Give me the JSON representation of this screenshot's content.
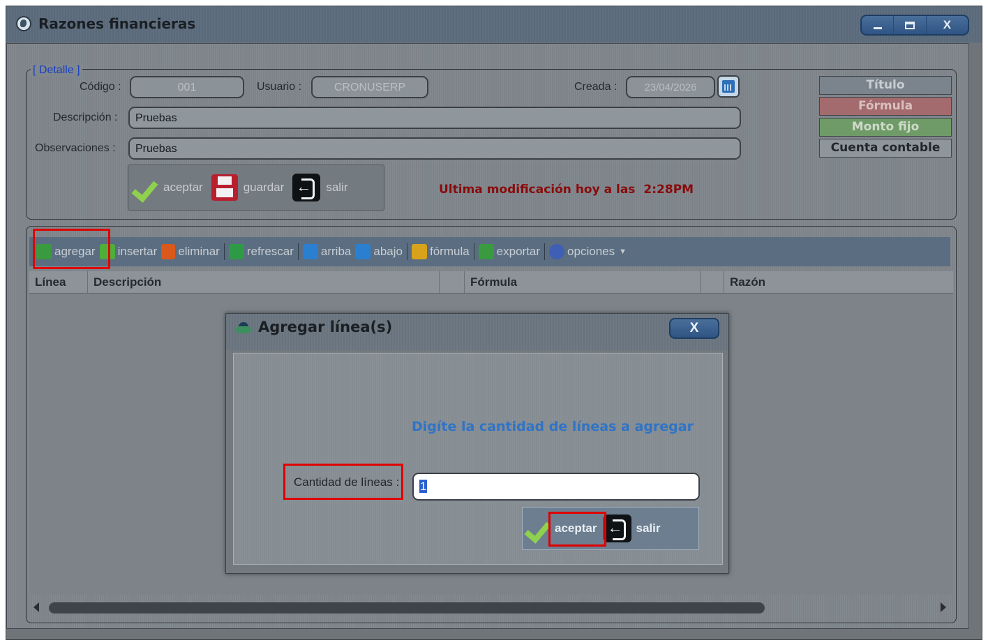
{
  "window": {
    "title": "Razones financieras",
    "controls": {
      "close": "X"
    }
  },
  "detail": {
    "legend": "[ Detalle ]",
    "codigo_label": "Código :",
    "codigo_value": "001",
    "usuario_label": "Usuario :",
    "usuario_value": "CRONUSERP",
    "creada_label": "Creada :",
    "creada_value": "23/04/2026",
    "descripcion_label": "Descripción :",
    "descripcion_value": "Pruebas",
    "observaciones_label": "Observaciones :",
    "observaciones_value": "Pruebas",
    "buttons": {
      "aceptar": "aceptar",
      "guardar": "guardar",
      "salir": "salir"
    },
    "last_modified_prefix": "Ultima modificación hoy a las",
    "last_modified_time": "2:28PM"
  },
  "legend_boxes": [
    {
      "label": "Título",
      "color": "#7b848c",
      "text_color": "#c9ced3"
    },
    {
      "label": "Fórmula",
      "color": "#a36b6d",
      "text_color": "#d9c0c0"
    },
    {
      "label": "Monto fijo",
      "color": "#6f9b68",
      "text_color": "#cdd9c9"
    },
    {
      "label": "Cuenta contable",
      "color": "#8e959b",
      "text_color": "#23272a"
    }
  ],
  "toolbar": {
    "items": [
      {
        "label": "agregar",
        "icon": "add-row-icon",
        "color": "#3a9a3f"
      },
      {
        "label": "insertar",
        "icon": "plus-icon",
        "color": "#4fae3a"
      },
      {
        "label": "eliminar",
        "icon": "trash-icon",
        "color": "#d9581a"
      },
      {
        "label": "refrescar",
        "icon": "refresh-icon",
        "color": "#2f9a45"
      },
      {
        "label": "arriba",
        "icon": "arrow-up-icon",
        "color": "#2a7fd0"
      },
      {
        "label": "abajo",
        "icon": "arrow-down-icon",
        "color": "#2a7fd0"
      },
      {
        "label": "fórmula",
        "icon": "formula-icon",
        "color": "#d8a21a"
      },
      {
        "label": "exportar",
        "icon": "export-icon",
        "color": "#3a9a3f"
      },
      {
        "label": "opciones",
        "icon": "options-icon",
        "color": "#3f5fb5"
      }
    ]
  },
  "grid": {
    "columns": [
      "Línea",
      "Descripción",
      "",
      "Fórmula",
      "",
      "Razón"
    ]
  },
  "dialog": {
    "title": "Agregar línea(s)",
    "close": "X",
    "message": "Digíte la cantidad de líneas a agregar",
    "field_label": "Cantidad de líneas :",
    "field_value": "1",
    "buttons": {
      "aceptar": "aceptar",
      "salir": "salir"
    }
  }
}
